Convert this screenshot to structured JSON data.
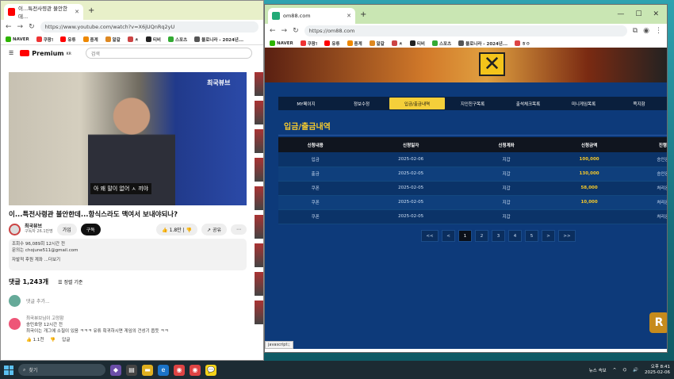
{
  "youtube": {
    "tab_title": "이...특전사령관 불안한데...",
    "url": "https://www.youtube.com/watch?v=X6jUQnRq2yU",
    "bookmarks": [
      "NAVER",
      "쿠팡!",
      "유튜",
      "중계",
      "알갈",
      "ㅊ",
      "티비",
      "스포츠",
      "블로니라 - 2024년..."
    ],
    "logo_text": "Premium",
    "logo_region": "KR",
    "search_placeholder": "검색",
    "subtitle": "아 왜 말이 없어 ㅅ 끼야",
    "video_badge": "최국뷰브",
    "video_title": "이...특전사령관 불안한데...항식스라도 맥여서 보내야되나?",
    "channel_name": "최국뷰브",
    "subscribers": "구독자 26.1만명",
    "join_label": "가입",
    "subscribe_label": "구독",
    "like_count": "1.8만",
    "share_label": "공유",
    "views": "조회수 96,089회 12시간 전",
    "contact": "문의는 chojune511@gmail.com",
    "desc_more": "자발적 후원 계좌 ...더보기",
    "comments_count": "댓글 1,243개",
    "sort_label": "정렬 기준",
    "comment_placeholder": "댓글 추가...",
    "pinned": "최국뷰브님이 고정함",
    "commenter": "송민호양 12시간 전",
    "comment_text": "최국이는 개그에 소질이 있음 ㅋㅋㅋ 유튜 획귀하시면 게임의 건성기 옵듯 ㅋㅋ",
    "comment_likes": "1.1천",
    "reply_label": "답글"
  },
  "site": {
    "tab_title": "om88.com",
    "url": "https://om88.com",
    "bookmarks": [
      "NAVER",
      "쿠팡!",
      "유튜",
      "중계",
      "알갈",
      "ㅊ",
      "티비",
      "스포츠",
      "블로니라 - 2024년...",
      "ㅎㅇ"
    ],
    "menu": [
      "MY페이지",
      "정보수정",
      "입금/출금내역",
      "지인친구목록",
      "출석체크목록",
      "미니게임목록",
      "쪽지함"
    ],
    "section_title": "입금/출금내역",
    "columns": [
      "신청내용",
      "신청일자",
      "신청계좌",
      "신청금액",
      "진행"
    ],
    "rows": [
      [
        "입금",
        "2025-02-06",
        "지갑",
        "100,000",
        "승인완"
      ],
      [
        "출금",
        "2025-02-05",
        "지갑",
        "130,000",
        "승인완"
      ],
      [
        "쿠폰",
        "2025-02-05",
        "지갑",
        "58,000",
        "처리완"
      ],
      [
        "쿠폰",
        "2025-02-05",
        "지갑",
        "10,000",
        "처리완"
      ],
      [
        "쿠폰",
        "2025-02-05",
        "지갑",
        "",
        "처리완"
      ]
    ],
    "pages": [
      "<<",
      "<",
      "1",
      "2",
      "3",
      "4",
      "5",
      ">",
      ">>"
    ],
    "chip": "R",
    "status": "javascript:;"
  },
  "taskbar": {
    "search_placeholder": "찾기",
    "news": "뉴스 속보",
    "time": "오후 8:41",
    "date": "2025-02-06"
  }
}
